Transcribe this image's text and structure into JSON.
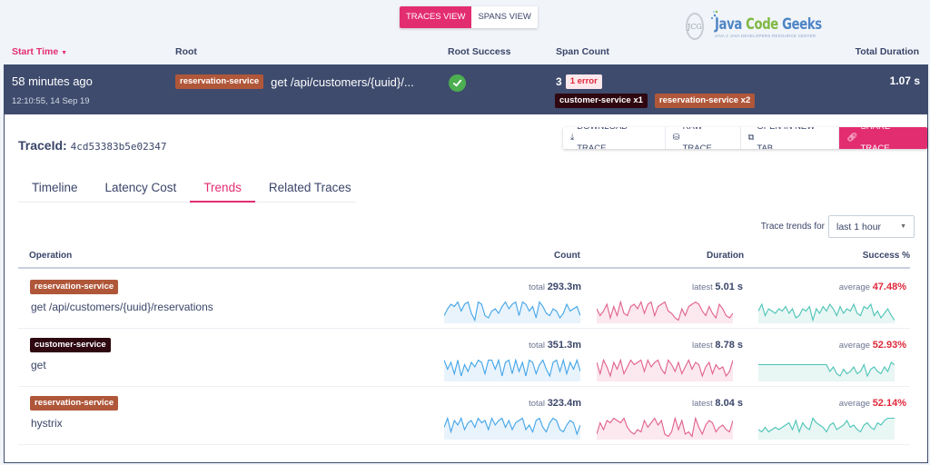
{
  "view_toggle": {
    "traces": "TRACES VIEW",
    "spans": "SPANS VIEW",
    "active": "traces"
  },
  "logo": {
    "circle": "JCG",
    "java": "Java",
    "code": "Code",
    "geeks": "Geeks",
    "tagline": "JAVA 2 JAVA DEVELOPERS RESOURCE CENTER"
  },
  "columns": {
    "start_time": "Start Time",
    "root": "Root",
    "root_success": "Root Success",
    "span_count": "Span Count",
    "total_duration": "Total Duration"
  },
  "trace": {
    "ago": "58 minutes ago",
    "date": "12:10:55, 14 Sep 19",
    "root_service": "reservation-service",
    "root_operation": "get /api/customers/{uuid}/...",
    "success": true,
    "span_count": "3",
    "errors": "1 error",
    "services": [
      "customer-service x1",
      "reservation-service x2"
    ],
    "duration": "1.07 s"
  },
  "detail": {
    "trace_id_label": "TraceId:",
    "trace_id": "4cd53383b5e02347",
    "actions": {
      "download": "DOWNLOAD TRACE",
      "raw": "RAW TRACE",
      "open": "OPEN IN NEW TAB",
      "share": "SHARE TRACE"
    },
    "tabs": [
      "Timeline",
      "Latency Cost",
      "Trends",
      "Related Traces"
    ],
    "active_tab": "Trends",
    "trend_for_label": "Trace trends for",
    "trend_for_value": "last 1 hour",
    "table_headers": {
      "operation": "Operation",
      "count": "Count",
      "duration": "Duration",
      "success": "Success %"
    },
    "rows": [
      {
        "service": "reservation-service",
        "service_color": "#b0573a",
        "operation": "get /api/customers/{uuid}/reservations",
        "count_label": "total",
        "count": "293.3m",
        "duration_label": "latest",
        "duration": "5.01 s",
        "success_label": "average",
        "success": "47.48%",
        "count_trend": [
          3,
          6,
          8,
          7,
          9,
          5,
          8,
          9,
          4,
          1,
          9,
          8,
          3,
          2,
          5,
          6,
          4,
          7,
          9,
          6,
          8,
          9,
          3,
          9,
          8,
          5,
          7,
          2,
          9,
          7,
          4,
          3,
          6,
          5,
          2,
          4,
          8,
          5,
          6,
          7,
          3
        ],
        "duration_trend": [
          6,
          3,
          5,
          8,
          2,
          7,
          3,
          9,
          4,
          3,
          7,
          8,
          6,
          9,
          4,
          8,
          9,
          3,
          7,
          8,
          9,
          5,
          4,
          2,
          1,
          6,
          3,
          7,
          8,
          9,
          8,
          5,
          3,
          7,
          4,
          2,
          8,
          6,
          3,
          2,
          4
        ],
        "success_trend": [
          5,
          8,
          3,
          6,
          5,
          4,
          6,
          5,
          7,
          4,
          6,
          2,
          3,
          6,
          5,
          7,
          1,
          6,
          4,
          7,
          5,
          8,
          6,
          3,
          7,
          4,
          6,
          5,
          8,
          4,
          3,
          7,
          6,
          8,
          3,
          5,
          2,
          4,
          6,
          3,
          1
        ]
      },
      {
        "service": "customer-service",
        "service_color": "#2e0710",
        "operation": "get",
        "count_label": "total",
        "count": "351.3m",
        "duration_label": "latest",
        "duration": "8.78 s",
        "success_label": "average",
        "success": "52.93%",
        "count_trend": [
          9,
          5,
          8,
          3,
          9,
          2,
          7,
          4,
          8,
          6,
          9,
          8,
          3,
          9,
          9,
          5,
          9,
          2,
          8,
          9,
          3,
          9,
          4,
          8,
          2,
          9,
          8,
          3,
          7,
          9,
          5,
          2,
          8,
          9,
          4,
          9,
          3,
          8,
          5,
          9,
          4
        ],
        "duration_trend": [
          8,
          3,
          9,
          6,
          2,
          8,
          5,
          9,
          3,
          6,
          9,
          7,
          8,
          9,
          4,
          9,
          6,
          8,
          9,
          5,
          3,
          9,
          7,
          4,
          8,
          3,
          6,
          9,
          5,
          8,
          7,
          2,
          6,
          8,
          3,
          7,
          5,
          6,
          2,
          4,
          9
        ],
        "success_trend": [
          7,
          7,
          7,
          7,
          7,
          7,
          7,
          7,
          7,
          7,
          7,
          7,
          7,
          7,
          7,
          7,
          7,
          7,
          7,
          7,
          7,
          4,
          6,
          3,
          2,
          5,
          3,
          4,
          6,
          3,
          4,
          7,
          2,
          5,
          6,
          4,
          3,
          6,
          4,
          8,
          7
        ]
      },
      {
        "service": "reservation-service",
        "service_color": "#b0573a",
        "operation": "hystrix",
        "count_label": "total",
        "count": "323.4m",
        "duration_label": "latest",
        "duration": "8.04 s",
        "success_label": "average",
        "success": "52.14%",
        "count_trend": [
          5,
          9,
          3,
          8,
          6,
          9,
          4,
          7,
          8,
          5,
          9,
          7,
          8,
          4,
          9,
          6,
          8,
          9,
          5,
          8,
          4,
          7,
          8,
          9,
          4,
          6,
          3,
          8,
          9,
          5,
          3,
          7,
          9,
          8,
          4,
          3,
          6,
          8,
          7,
          2,
          6
        ],
        "duration_trend": [
          2,
          7,
          4,
          8,
          7,
          9,
          8,
          7,
          9,
          5,
          3,
          2,
          4,
          3,
          8,
          5,
          7,
          9,
          6,
          8,
          2,
          1,
          3,
          9,
          4,
          8,
          2,
          3,
          1,
          9,
          5,
          2,
          6,
          8,
          7,
          3,
          5,
          6,
          4,
          3,
          8
        ],
        "success_trend": [
          4,
          3,
          5,
          3,
          4,
          5,
          4,
          5,
          6,
          7,
          4,
          8,
          3,
          7,
          5,
          4,
          9,
          7,
          6,
          5,
          3,
          6,
          7,
          4,
          5,
          6,
          8,
          5,
          6,
          4,
          3,
          6,
          7,
          5,
          4,
          7,
          6,
          8,
          9,
          9,
          9
        ]
      }
    ]
  },
  "colors": {
    "accent": "#e32d71",
    "header_bg": "#3e4b6d",
    "count_line": "#42a5e8",
    "duration_line": "#e0628a",
    "success_line": "#4cc4b6",
    "error": "#e0293b"
  }
}
